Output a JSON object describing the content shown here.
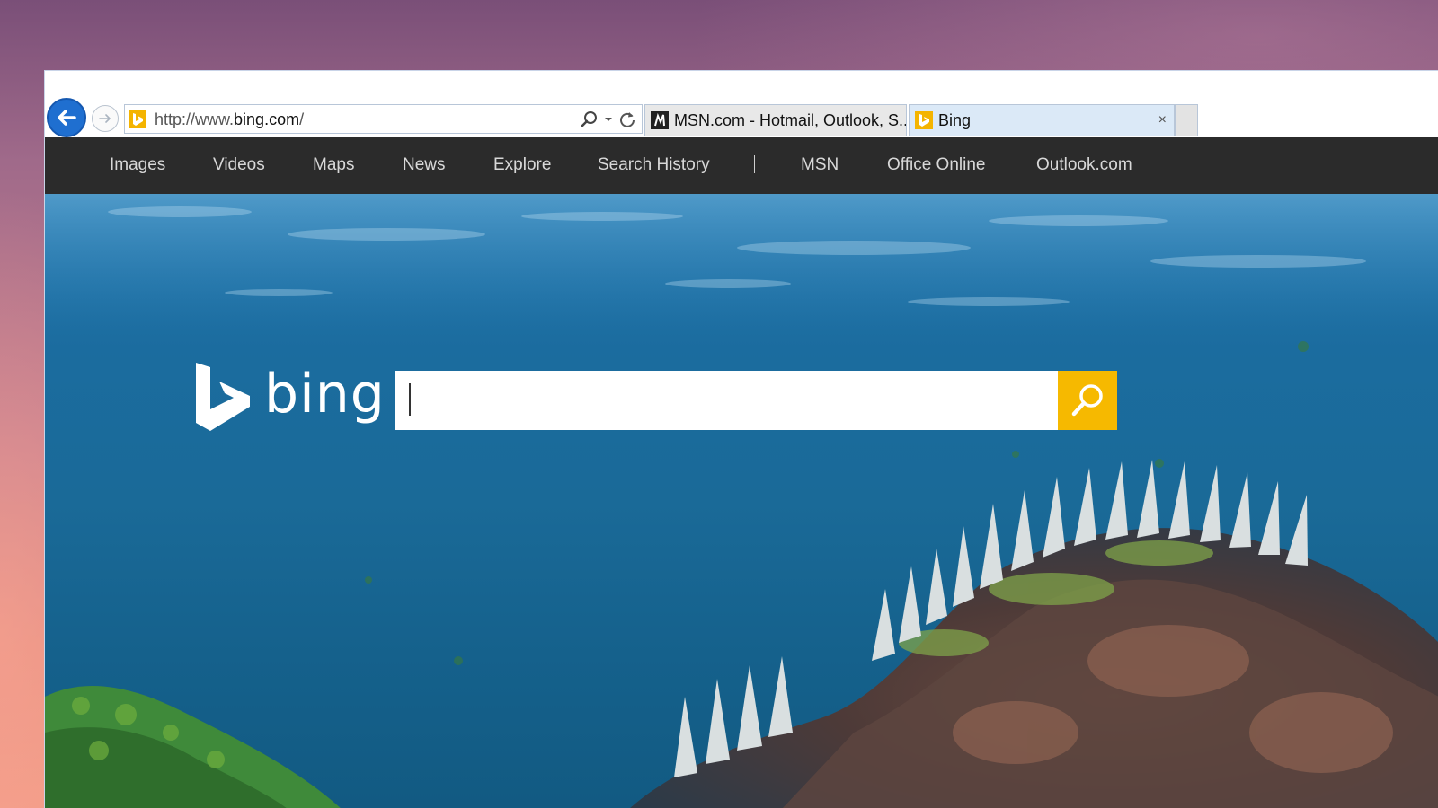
{
  "browser": {
    "address": {
      "url_prefix": "http://www.",
      "url_domain": "bing.com",
      "url_suffix": "/"
    },
    "tabs": [
      {
        "label": "MSN.com - Hotmail, Outlook, S...",
        "active": false
      },
      {
        "label": "Bing",
        "active": true,
        "close": "×"
      }
    ]
  },
  "nav": {
    "items": [
      "Images",
      "Videos",
      "Maps",
      "News",
      "Explore",
      "Search History",
      "MSN",
      "Office Online",
      "Outlook.com"
    ]
  },
  "bing": {
    "logo_text": "bing",
    "search_value": ""
  },
  "colors": {
    "accent": "#f6b900",
    "back_button": "#1f6fd0",
    "navbar": "#2b2b2b",
    "water": "#1b6c9f"
  },
  "icons": [
    "back-arrow-icon",
    "forward-arrow-icon",
    "bing-favicon-icon",
    "search-icon",
    "dropdown-icon",
    "refresh-icon",
    "msn-favicon-icon",
    "close-icon",
    "magnifier-icon"
  ]
}
